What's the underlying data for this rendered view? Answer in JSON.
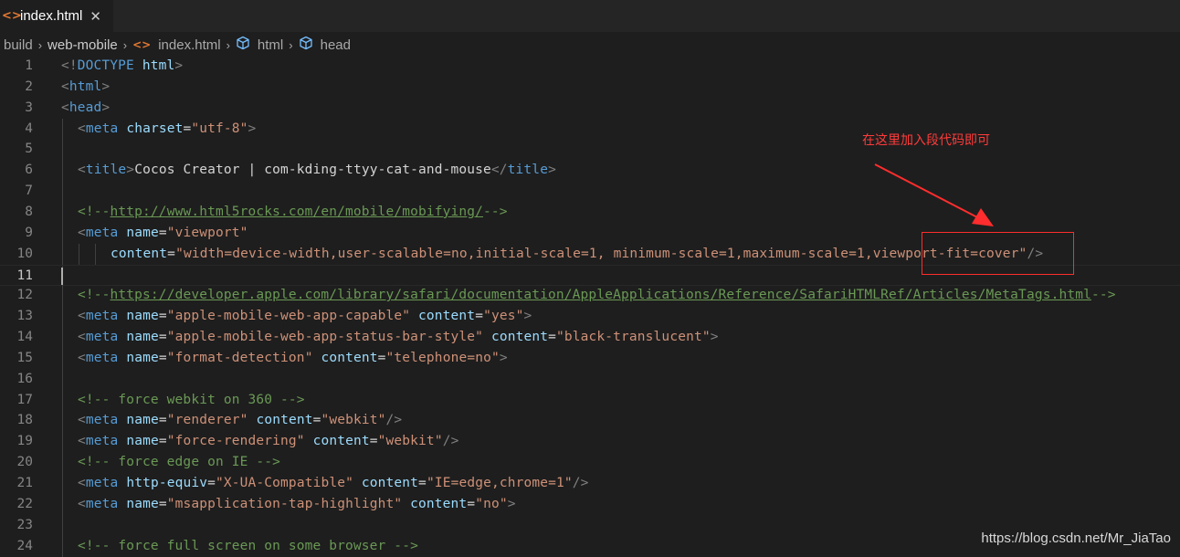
{
  "tab": {
    "icon": "html-code-icon",
    "label": "index.html",
    "close": "✕"
  },
  "breadcrumb": {
    "items": [
      {
        "label": "build"
      },
      {
        "label": "web-mobile"
      },
      {
        "label": "index.html",
        "icon": "html-code-icon"
      },
      {
        "label": "html",
        "icon": "cube-icon"
      },
      {
        "label": "head",
        "icon": "cube-icon"
      }
    ],
    "separator": "›"
  },
  "editor": {
    "cursor_line": 11,
    "lines": [
      {
        "n": "1",
        "indent": 0,
        "tokens": [
          [
            "br",
            "<!"
          ],
          [
            "tag",
            "DOCTYPE"
          ],
          [
            "txt",
            " "
          ],
          [
            "attr",
            "html"
          ],
          [
            "br",
            ">"
          ]
        ]
      },
      {
        "n": "2",
        "indent": 0,
        "tokens": [
          [
            "br",
            "<"
          ],
          [
            "tag",
            "html"
          ],
          [
            "br",
            ">"
          ]
        ]
      },
      {
        "n": "3",
        "indent": 0,
        "tokens": [
          [
            "br",
            "<"
          ],
          [
            "tag",
            "head"
          ],
          [
            "br",
            ">"
          ]
        ]
      },
      {
        "n": "4",
        "indent": 1,
        "tokens": [
          [
            "br",
            "<"
          ],
          [
            "tag",
            "meta"
          ],
          [
            "txt",
            " "
          ],
          [
            "attr",
            "charset"
          ],
          [
            "txt",
            "="
          ],
          [
            "str",
            "\"utf-8\""
          ],
          [
            "br",
            ">"
          ]
        ]
      },
      {
        "n": "5",
        "indent": 1,
        "tokens": []
      },
      {
        "n": "6",
        "indent": 1,
        "tokens": [
          [
            "br",
            "<"
          ],
          [
            "tag",
            "title"
          ],
          [
            "br",
            ">"
          ],
          [
            "txt",
            "Cocos Creator | com-kding-ttyy-cat-and-mouse"
          ],
          [
            "br",
            "</"
          ],
          [
            "tag",
            "title"
          ],
          [
            "br",
            ">"
          ]
        ]
      },
      {
        "n": "7",
        "indent": 1,
        "tokens": []
      },
      {
        "n": "8",
        "indent": 1,
        "tokens": [
          [
            "cmt",
            "<!--"
          ],
          [
            "url",
            "http://www.html5rocks.com/en/mobile/mobifying/"
          ],
          [
            "cmt",
            "-->"
          ]
        ]
      },
      {
        "n": "9",
        "indent": 1,
        "tokens": [
          [
            "br",
            "<"
          ],
          [
            "tag",
            "meta"
          ],
          [
            "txt",
            " "
          ],
          [
            "attr",
            "name"
          ],
          [
            "txt",
            "="
          ],
          [
            "str",
            "\"viewport\""
          ]
        ]
      },
      {
        "n": "10",
        "indent": 3,
        "tokens": [
          [
            "attr",
            "content"
          ],
          [
            "txt",
            "="
          ],
          [
            "str",
            "\"width=device-width,user-scalable=no,initial-scale=1, minimum-scale=1,maximum-scale=1,viewport-fit=cover\""
          ],
          [
            "br",
            "/>"
          ]
        ]
      },
      {
        "n": "11",
        "indent": 1,
        "tokens": []
      },
      {
        "n": "12",
        "indent": 1,
        "tokens": [
          [
            "cmt",
            "<!--"
          ],
          [
            "url",
            "https://developer.apple.com/library/safari/documentation/AppleApplications/Reference/SafariHTMLRef/Articles/MetaTags.html"
          ],
          [
            "cmt",
            "-->"
          ]
        ]
      },
      {
        "n": "13",
        "indent": 1,
        "tokens": [
          [
            "br",
            "<"
          ],
          [
            "tag",
            "meta"
          ],
          [
            "txt",
            " "
          ],
          [
            "attr",
            "name"
          ],
          [
            "txt",
            "="
          ],
          [
            "str",
            "\"apple-mobile-web-app-capable\""
          ],
          [
            "txt",
            " "
          ],
          [
            "attr",
            "content"
          ],
          [
            "txt",
            "="
          ],
          [
            "str",
            "\"yes\""
          ],
          [
            "br",
            ">"
          ]
        ]
      },
      {
        "n": "14",
        "indent": 1,
        "tokens": [
          [
            "br",
            "<"
          ],
          [
            "tag",
            "meta"
          ],
          [
            "txt",
            " "
          ],
          [
            "attr",
            "name"
          ],
          [
            "txt",
            "="
          ],
          [
            "str",
            "\"apple-mobile-web-app-status-bar-style\""
          ],
          [
            "txt",
            " "
          ],
          [
            "attr",
            "content"
          ],
          [
            "txt",
            "="
          ],
          [
            "str",
            "\"black-translucent\""
          ],
          [
            "br",
            ">"
          ]
        ]
      },
      {
        "n": "15",
        "indent": 1,
        "tokens": [
          [
            "br",
            "<"
          ],
          [
            "tag",
            "meta"
          ],
          [
            "txt",
            " "
          ],
          [
            "attr",
            "name"
          ],
          [
            "txt",
            "="
          ],
          [
            "str",
            "\"format-detection\""
          ],
          [
            "txt",
            " "
          ],
          [
            "attr",
            "content"
          ],
          [
            "txt",
            "="
          ],
          [
            "str",
            "\"telephone=no\""
          ],
          [
            "br",
            ">"
          ]
        ]
      },
      {
        "n": "16",
        "indent": 1,
        "tokens": []
      },
      {
        "n": "17",
        "indent": 1,
        "tokens": [
          [
            "cmt",
            "<!-- force webkit on 360 -->"
          ]
        ]
      },
      {
        "n": "18",
        "indent": 1,
        "tokens": [
          [
            "br",
            "<"
          ],
          [
            "tag",
            "meta"
          ],
          [
            "txt",
            " "
          ],
          [
            "attr",
            "name"
          ],
          [
            "txt",
            "="
          ],
          [
            "str",
            "\"renderer\""
          ],
          [
            "txt",
            " "
          ],
          [
            "attr",
            "content"
          ],
          [
            "txt",
            "="
          ],
          [
            "str",
            "\"webkit\""
          ],
          [
            "br",
            "/>"
          ]
        ]
      },
      {
        "n": "19",
        "indent": 1,
        "tokens": [
          [
            "br",
            "<"
          ],
          [
            "tag",
            "meta"
          ],
          [
            "txt",
            " "
          ],
          [
            "attr",
            "name"
          ],
          [
            "txt",
            "="
          ],
          [
            "str",
            "\"force-rendering\""
          ],
          [
            "txt",
            " "
          ],
          [
            "attr",
            "content"
          ],
          [
            "txt",
            "="
          ],
          [
            "str",
            "\"webkit\""
          ],
          [
            "br",
            "/>"
          ]
        ]
      },
      {
        "n": "20",
        "indent": 1,
        "tokens": [
          [
            "cmt",
            "<!-- force edge on IE -->"
          ]
        ]
      },
      {
        "n": "21",
        "indent": 1,
        "tokens": [
          [
            "br",
            "<"
          ],
          [
            "tag",
            "meta"
          ],
          [
            "txt",
            " "
          ],
          [
            "attr",
            "http-equiv"
          ],
          [
            "txt",
            "="
          ],
          [
            "str",
            "\"X-UA-Compatible\""
          ],
          [
            "txt",
            " "
          ],
          [
            "attr",
            "content"
          ],
          [
            "txt",
            "="
          ],
          [
            "str",
            "\"IE=edge,chrome=1\""
          ],
          [
            "br",
            "/>"
          ]
        ]
      },
      {
        "n": "22",
        "indent": 1,
        "tokens": [
          [
            "br",
            "<"
          ],
          [
            "tag",
            "meta"
          ],
          [
            "txt",
            " "
          ],
          [
            "attr",
            "name"
          ],
          [
            "txt",
            "="
          ],
          [
            "str",
            "\"msapplication-tap-highlight\""
          ],
          [
            "txt",
            " "
          ],
          [
            "attr",
            "content"
          ],
          [
            "txt",
            "="
          ],
          [
            "str",
            "\"no\""
          ],
          [
            "br",
            ">"
          ]
        ]
      },
      {
        "n": "23",
        "indent": 1,
        "tokens": []
      },
      {
        "n": "24",
        "indent": 1,
        "tokens": [
          [
            "cmt",
            "<!-- force full screen on some browser -->"
          ]
        ]
      }
    ]
  },
  "annotation": {
    "text": "在这里加入段代码即可",
    "color": "#ff2d2d"
  },
  "watermark": "https://blog.csdn.net/Mr_JiaTao",
  "colors": {
    "background": "#1e1e1e",
    "tag": "#569cd6",
    "attribute": "#9cdcfe",
    "string": "#ce9178",
    "comment": "#6a9955",
    "bracket": "#808080",
    "annotation": "#ff2d2d",
    "file_icon": "#e37933"
  }
}
